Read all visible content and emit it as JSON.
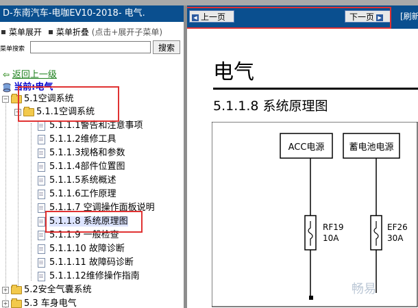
{
  "left": {
    "title": "D-东南汽车-电咖EV10-2018- 电气.",
    "menu_expand": "菜单展开",
    "menu_collapse": "菜单折叠",
    "menu_hint": "(点击+展开子菜单)",
    "search_label": "菜单搜索",
    "search_value": "",
    "search_button": "搜索",
    "back_link": "返回上一级",
    "current": "当前:电气",
    "tree": [
      {
        "label": "5.1空调系统"
      },
      {
        "label": "5.1.1空调系统"
      },
      {
        "label": "5.1.1.1警告和注意事项"
      },
      {
        "label": "5.1.1.2维修工具"
      },
      {
        "label": "5.1.1.3规格和参数"
      },
      {
        "label": "5.1.1.4部件位置图"
      },
      {
        "label": "5.1.1.5系统概述"
      },
      {
        "label": "5.1.1.6工作原理"
      },
      {
        "label": "5.1.1.7 空调操作面板说明"
      },
      {
        "label": "5.1.1.8 系统原理图"
      },
      {
        "label": "5.1.1.9 一般检查"
      },
      {
        "label": "5.1.1.10 故障诊断"
      },
      {
        "label": "5.1.1.11 故障码诊断"
      },
      {
        "label": "5.1.1.12维修操作指南"
      },
      {
        "label": "5.2安全气囊系统"
      },
      {
        "label": "5.3 车身电气"
      }
    ]
  },
  "right": {
    "prev": "上一页",
    "next": "下一页",
    "refresh": "[刷新",
    "doc_title": "电气",
    "doc_subtitle": "5.1.1.8 系统原理图",
    "boxes": {
      "acc": "ACC电源",
      "battery": "蓄电池电源"
    },
    "fuses": [
      {
        "name": "RF19",
        "rating": "10A"
      },
      {
        "name": "EF26",
        "rating": "30A"
      }
    ],
    "watermark": "畅易"
  },
  "colors": {
    "titlebar": "#0a4f8f",
    "highlight": "#e03131",
    "back_link": "#1a7f1a",
    "current": "#0000cc"
  }
}
